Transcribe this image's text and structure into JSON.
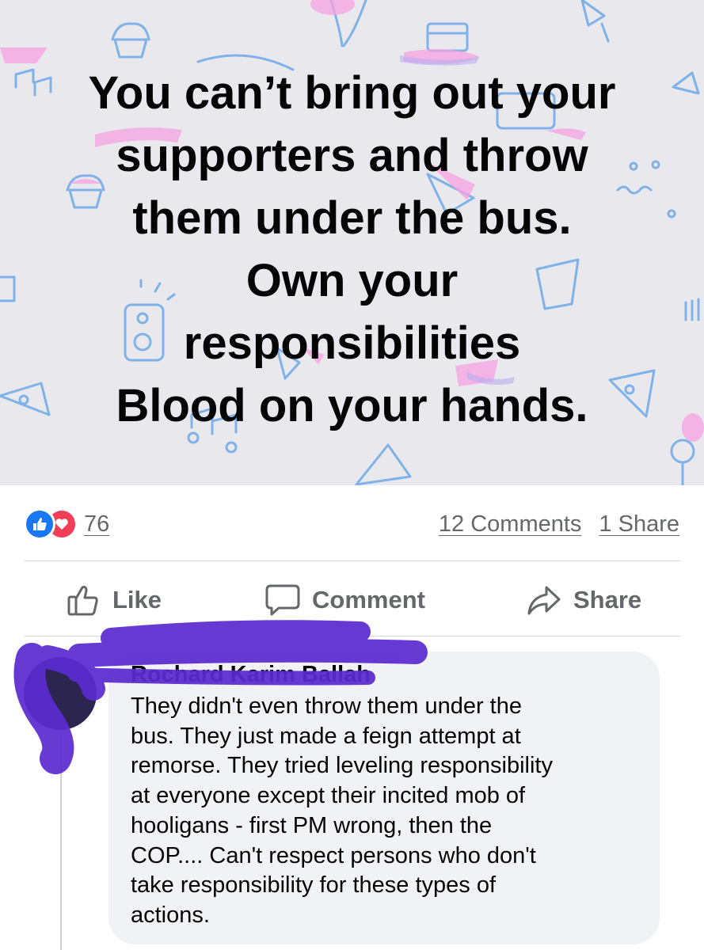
{
  "post": {
    "text_lines": [
      "You can’t bring out your",
      "supporters and throw",
      "them under the bus.",
      "Own your",
      "responsibilities",
      "Blood on your hands."
    ],
    "background_color": "#e9e8ed"
  },
  "reactions": {
    "icons": [
      "like-reaction-icon",
      "love-reaction-icon"
    ],
    "count": "76"
  },
  "stats": {
    "comments": "12 Comments",
    "shares": "1 Share"
  },
  "actions": {
    "like_label": "Like",
    "comment_label": "Comment",
    "share_label": "Share"
  },
  "comment": {
    "author": "Rochard Karim Ballah",
    "body_lines": [
      "They didn't even throw them under the",
      "bus. They just made a feign attempt at",
      "remorse. They tried leveling responsibility",
      "at everyone except their incited mob of",
      "hooligans - first PM wrong, then the",
      "COP.... Can't respect persons who don't",
      "take responsibility for these types of",
      "actions."
    ]
  },
  "colors": {
    "like_blue": "#1877f2",
    "love_red": "#f33e58",
    "secondary_text": "#65676b",
    "bubble_bg": "#f0f2f5",
    "redaction_purple": "#5b2bd0"
  }
}
